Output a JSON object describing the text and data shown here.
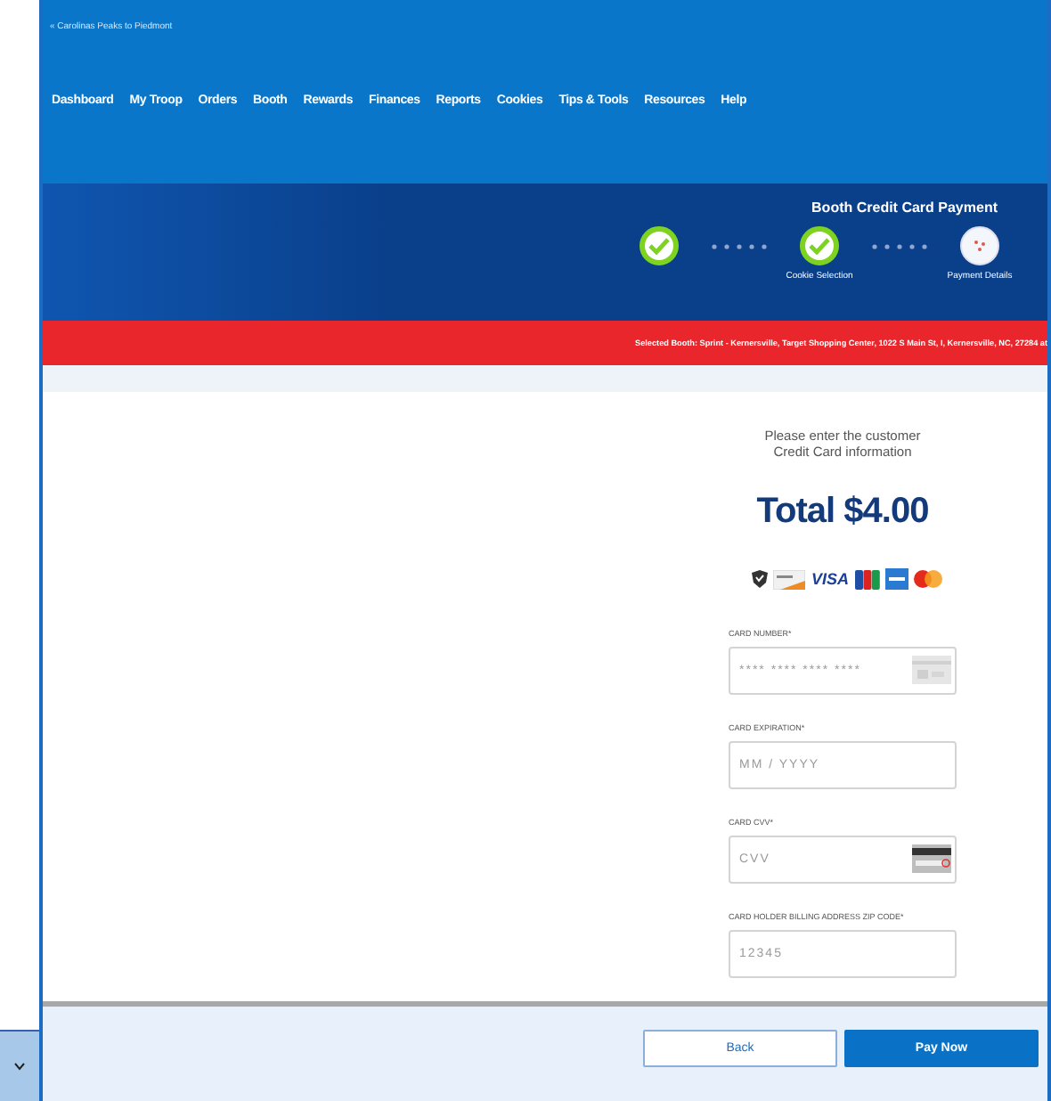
{
  "org_link": "« Carolinas Peaks to Piedmont",
  "nav": [
    "Dashboard",
    "My Troop",
    "Orders",
    "Booth",
    "Rewards",
    "Finances",
    "Reports",
    "Cookies",
    "Tips & Tools",
    "Resources",
    "Help"
  ],
  "header": {
    "title": "Booth Credit Card Payment",
    "steps": [
      {
        "completed": true
      },
      {
        "label": "Cookie Selection",
        "completed": true
      },
      {
        "label": "Payment Details",
        "completed": false
      }
    ]
  },
  "banner": "Selected Booth: Sprint - Kernersville, Target Shopping Center, 1022 S Main St, I, Kernersville, NC, 27284 at",
  "payment": {
    "prompt": "Please enter the customer Credit Card information",
    "total": "Total $4.00",
    "visa_text": "VISA",
    "fields": [
      {
        "label": "CARD NUMBER*",
        "placeholder": "**** **** **** ****",
        "kind": "card"
      },
      {
        "label": "CARD EXPIRATION*",
        "placeholder": "MM / YYYY",
        "kind": "plain"
      },
      {
        "label": "CARD CVV*",
        "placeholder": "CVV",
        "kind": "cvv"
      },
      {
        "label": "CARD HOLDER BILLING ADDRESS ZIP CODE*",
        "placeholder": "12345",
        "kind": "plain"
      }
    ]
  },
  "buttons": [
    {
      "label": "Back",
      "kind": "secondary"
    },
    {
      "label": "Pay Now",
      "kind": "primary"
    }
  ]
}
